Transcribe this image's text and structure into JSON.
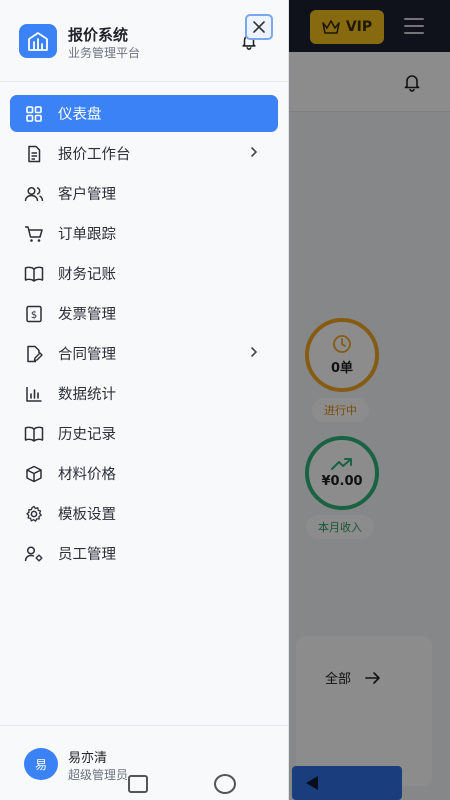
{
  "background": {
    "vip_label": "VIP",
    "orders_value": "0单",
    "orders_status": "进行中",
    "income_value": "¥0.00",
    "income_label": "本月收入",
    "view_all_label": "全部"
  },
  "drawer": {
    "app_title": "报价系统",
    "app_subtitle": "业务管理平台",
    "items": [
      {
        "label": "仪表盘",
        "icon": "dashboard-icon",
        "active": true,
        "has_submenu": false
      },
      {
        "label": "报价工作台",
        "icon": "document-icon",
        "active": false,
        "has_submenu": true
      },
      {
        "label": "客户管理",
        "icon": "users-icon",
        "active": false,
        "has_submenu": false
      },
      {
        "label": "订单跟踪",
        "icon": "cart-icon",
        "active": false,
        "has_submenu": false
      },
      {
        "label": "财务记账",
        "icon": "book-icon",
        "active": false,
        "has_submenu": false
      },
      {
        "label": "发票管理",
        "icon": "invoice-icon",
        "active": false,
        "has_submenu": false
      },
      {
        "label": "合同管理",
        "icon": "contract-icon",
        "active": false,
        "has_submenu": true
      },
      {
        "label": "数据统计",
        "icon": "bar-chart-icon",
        "active": false,
        "has_submenu": false
      },
      {
        "label": "历史记录",
        "icon": "book-icon",
        "active": false,
        "has_submenu": false
      },
      {
        "label": "材料价格",
        "icon": "package-icon",
        "active": false,
        "has_submenu": false
      },
      {
        "label": "模板设置",
        "icon": "gear-icon",
        "active": false,
        "has_submenu": false
      },
      {
        "label": "员工管理",
        "icon": "user-gear-icon",
        "active": false,
        "has_submenu": false
      }
    ],
    "user": {
      "avatar_text": "易",
      "name": "易亦清",
      "role": "超级管理员"
    }
  },
  "colors": {
    "accent": "#3b82f6",
    "vip": "#f6c21c",
    "orders_ring": "#f5a623",
    "income_ring": "#2fb37c"
  }
}
